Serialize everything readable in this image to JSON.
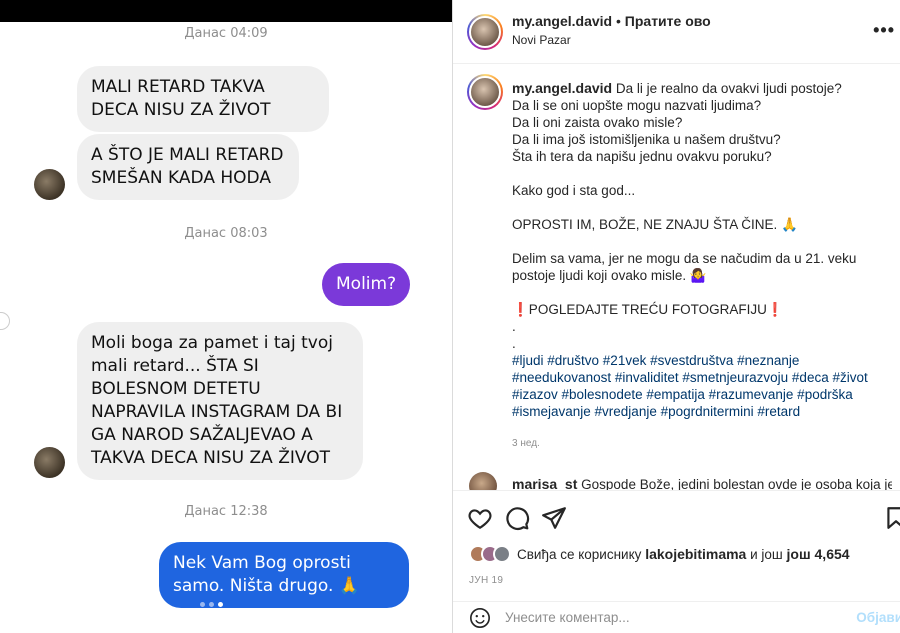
{
  "chat": {
    "timestamps": [
      "Данас 04:09",
      "Данас 08:03",
      "Данас 12:38"
    ],
    "messages": [
      {
        "text": "MALI RETARD TAKVA DECA NISU ZA ŽIVOT"
      },
      {
        "text": "A ŠTO JE MALI RETARD SMEŠAN KADA HODA"
      },
      {
        "text": "Molim?"
      },
      {
        "text": "Moli boga za pamet i taj tvoj mali retard... ŠTA SI BOLESNOM DETETU NAPRAVILA INSTAGRAM DA BI GA NAROD SAŽALJEVAO A TAKVA DECA NISU ZA ŽIVOT"
      },
      {
        "text": "Nek Vam Bog oprosti samo. Ništa drugo. 🙏"
      }
    ]
  },
  "post": {
    "username": "my.angel.david",
    "separator": "•",
    "follow_label": "Пратите ово",
    "location": "Novi Pazar",
    "more_label": "•••",
    "caption_lines": [
      "Da li je realno da ovakvi ljudi postoje?",
      "Da li se oni uopšte mogu nazvati ljudima?",
      "Da li oni zaista ovako misle?",
      "Da li ima još istomišljenika u našem društvu?",
      "Šta ih tera da napišu jednu ovakvu poruku?",
      "",
      "Kako god i sta god...",
      "",
      "OPROSTI IM, BOŽE, NE ZNAJU ŠTA ČINE. 🙏",
      "",
      "Delim sa vama, jer ne mogu da se načudim da u 21. veku postoje ljudi koji ovako misle. 🤷‍♀️",
      "",
      "❗POGLEDAJTE TREĆU FOTOGRAFIJU❗",
      ".",
      "."
    ],
    "hashtags": "#ljudi #društvo #21vek #svestdruštva #neznanje #needukovanost #invaliditet #smetnjeurazvoju #deca #život #izazov #bolesnodete #empatija #razumevanje #podrška #ismejavanje #vredjanje #pogrdnitermini #retard",
    "age": "3 нед.",
    "comment_user": "marisa_st",
    "comment_text": "Gospode Bože, jedini bolestan ovde je osoba koja je",
    "likes_prefix": "Свиђа се кориснику",
    "likes_user": "lakojebitimama",
    "likes_mid": "и још",
    "likes_count": "још 4,654",
    "date": "ЈУН 19",
    "comment_placeholder": "Унесите коментар...",
    "post_button": "Објави"
  },
  "colors": {
    "incoming": "#efefef",
    "outgoing_purple": "#7b39d9",
    "outgoing_blue": "#1f65e0",
    "hashtag": "#00376b"
  }
}
